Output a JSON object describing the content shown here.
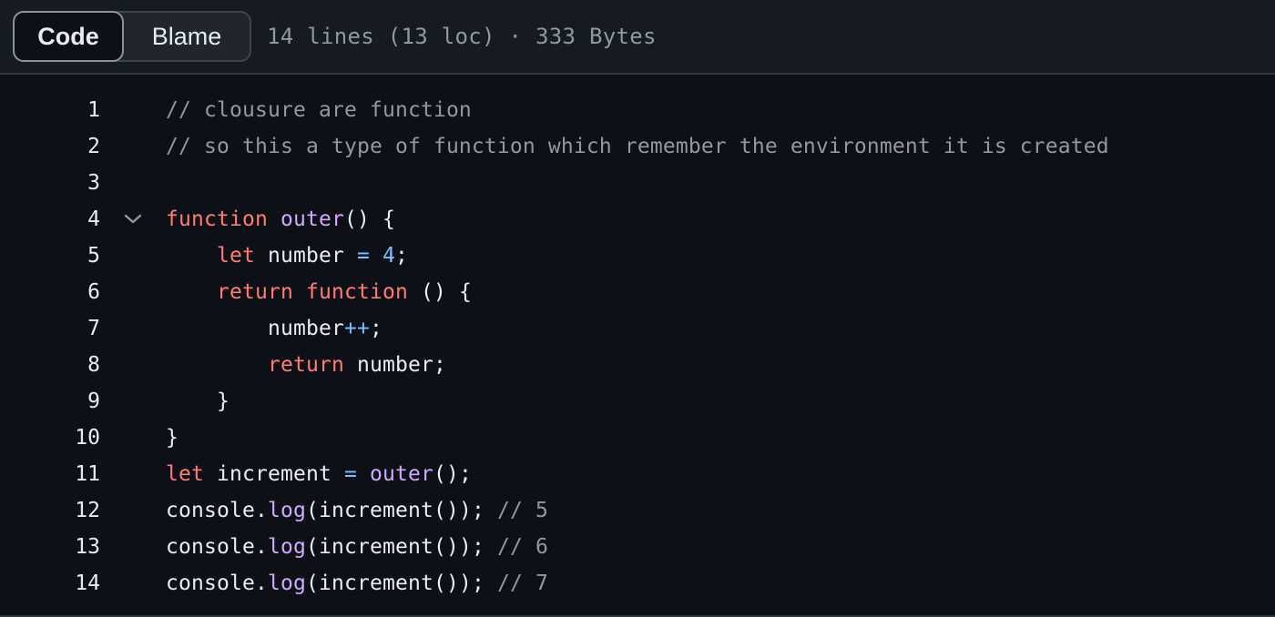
{
  "tabs": {
    "code_label": "Code",
    "blame_label": "Blame"
  },
  "file_info": "14 lines (13 loc) · 333 Bytes",
  "code_lines": [
    {
      "n": "1",
      "tokens": [
        {
          "t": "// clousure are function",
          "c": "cm"
        }
      ]
    },
    {
      "n": "2",
      "tokens": [
        {
          "t": "// so this a type of function which remember the environment it is created",
          "c": "cm"
        }
      ]
    },
    {
      "n": "3",
      "tokens": []
    },
    {
      "n": "4",
      "fold": true,
      "tokens": [
        {
          "t": "function",
          "c": "kw"
        },
        {
          "t": " ",
          "c": ""
        },
        {
          "t": "outer",
          "c": "fn"
        },
        {
          "t": "() {",
          "c": ""
        }
      ]
    },
    {
      "n": "5",
      "tokens": [
        {
          "t": "    ",
          "c": ""
        },
        {
          "t": "let",
          "c": "kw"
        },
        {
          "t": " number ",
          "c": ""
        },
        {
          "t": "=",
          "c": "op"
        },
        {
          "t": " ",
          "c": ""
        },
        {
          "t": "4",
          "c": "num"
        },
        {
          "t": ";",
          "c": ""
        }
      ]
    },
    {
      "n": "6",
      "tokens": [
        {
          "t": "    ",
          "c": ""
        },
        {
          "t": "return",
          "c": "kw"
        },
        {
          "t": " ",
          "c": ""
        },
        {
          "t": "function",
          "c": "kw"
        },
        {
          "t": " () {",
          "c": ""
        }
      ]
    },
    {
      "n": "7",
      "tokens": [
        {
          "t": "        number",
          "c": ""
        },
        {
          "t": "++",
          "c": "op"
        },
        {
          "t": ";",
          "c": ""
        }
      ]
    },
    {
      "n": "8",
      "tokens": [
        {
          "t": "        ",
          "c": ""
        },
        {
          "t": "return",
          "c": "kw"
        },
        {
          "t": " number;",
          "c": ""
        }
      ]
    },
    {
      "n": "9",
      "tokens": [
        {
          "t": "    }",
          "c": ""
        }
      ]
    },
    {
      "n": "10",
      "tokens": [
        {
          "t": "}",
          "c": ""
        }
      ]
    },
    {
      "n": "11",
      "tokens": [
        {
          "t": "let",
          "c": "kw"
        },
        {
          "t": " increment ",
          "c": ""
        },
        {
          "t": "=",
          "c": "op"
        },
        {
          "t": " ",
          "c": ""
        },
        {
          "t": "outer",
          "c": "fn"
        },
        {
          "t": "();",
          "c": ""
        }
      ]
    },
    {
      "n": "12",
      "tokens": [
        {
          "t": "console.",
          "c": ""
        },
        {
          "t": "log",
          "c": "fn"
        },
        {
          "t": "(increment()); ",
          "c": ""
        },
        {
          "t": "// 5",
          "c": "cm"
        }
      ]
    },
    {
      "n": "13",
      "tokens": [
        {
          "t": "console.",
          "c": ""
        },
        {
          "t": "log",
          "c": "fn"
        },
        {
          "t": "(increment()); ",
          "c": ""
        },
        {
          "t": "// 6",
          "c": "cm"
        }
      ]
    },
    {
      "n": "14",
      "tokens": [
        {
          "t": "console.",
          "c": ""
        },
        {
          "t": "log",
          "c": "fn"
        },
        {
          "t": "(increment()); ",
          "c": ""
        },
        {
          "t": "// 7",
          "c": "cm"
        }
      ]
    }
  ],
  "icons": {
    "fold": "chevron-down-icon"
  },
  "colors": {
    "background": "#0d1117",
    "header_background": "#161b22",
    "keyword": "#ff7b72",
    "function_name": "#d2a8ff",
    "number": "#79c0ff",
    "comment": "#9198a1",
    "text": "#e6edf3"
  }
}
